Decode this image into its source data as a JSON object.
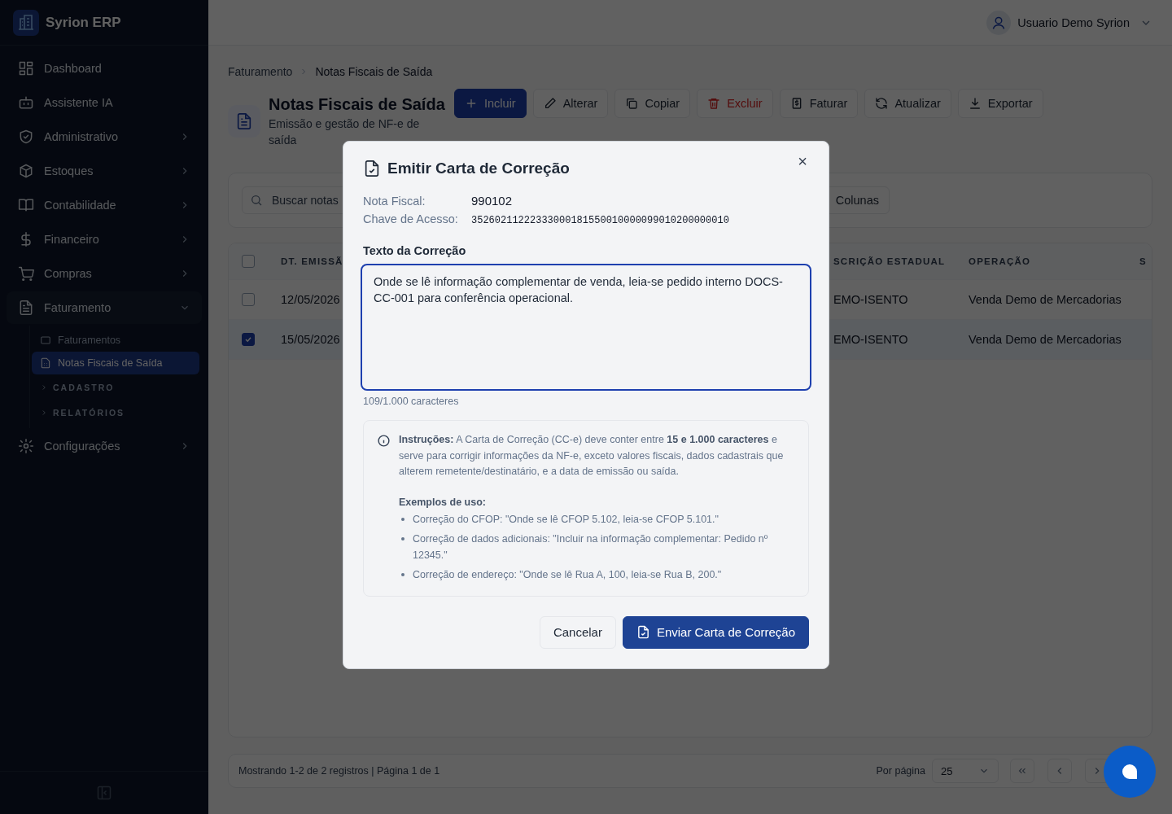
{
  "app": {
    "name": "Syrion ERP"
  },
  "sidebar": {
    "items": [
      {
        "label": "Dashboard",
        "kind": "link"
      },
      {
        "label": "Assistente IA",
        "kind": "link"
      },
      {
        "label": "Administrativo",
        "kind": "menu",
        "expanded": false
      },
      {
        "label": "Estoques",
        "kind": "menu",
        "expanded": false
      },
      {
        "label": "Contabilidade",
        "kind": "menu",
        "expanded": false
      },
      {
        "label": "Financeiro",
        "kind": "menu",
        "expanded": false
      },
      {
        "label": "Compras",
        "kind": "menu",
        "expanded": false
      },
      {
        "label": "Faturamento",
        "kind": "menu",
        "expanded": true,
        "children": [
          {
            "label": "Faturamentos",
            "kind": "page",
            "selected": false
          },
          {
            "label": "Notas Fiscais de Saída",
            "kind": "page",
            "selected": true
          },
          {
            "label": "CADASTRO",
            "kind": "group",
            "expanded": false
          },
          {
            "label": "RELATÓRIOS",
            "kind": "group",
            "expanded": false
          }
        ]
      },
      {
        "label": "Configurações",
        "kind": "menu",
        "expanded": false
      }
    ]
  },
  "user": {
    "name": "Usuario Demo Syrion"
  },
  "breadcrumb": [
    "Faturamento",
    "Notas Fiscais de Saída"
  ],
  "page": {
    "title": "Notas Fiscais de Saída",
    "subtitle": "Emissão e gestão de NF-e de saída"
  },
  "toolbar": [
    {
      "label": "Incluir",
      "kind": "primary"
    },
    {
      "label": "Alterar",
      "kind": "default"
    },
    {
      "label": "Copiar",
      "kind": "default"
    },
    {
      "label": "Excluir",
      "kind": "danger"
    },
    {
      "label": "Faturar",
      "kind": "default"
    },
    {
      "label": "Atualizar",
      "kind": "default"
    },
    {
      "label": "Exportar",
      "kind": "default"
    }
  ],
  "filters": {
    "search": {
      "placeholder": "Buscar notas"
    },
    "columns_button": "Colunas"
  },
  "table": {
    "columns": [
      "DT. EMISSÃ",
      "SCRIÇÃO ESTADUAL",
      "OPERAÇÃO",
      "S"
    ],
    "header_checked": false,
    "rows": [
      {
        "selected": false,
        "cells": [
          "12/05/2026",
          "EMO-ISENTO",
          "Venda Demo de Mercadorias"
        ]
      },
      {
        "selected": true,
        "cells": [
          "15/05/2026",
          "EMO-ISENTO",
          "Venda Demo de Mercadorias"
        ]
      }
    ]
  },
  "footer": {
    "summary": "Mostrando 1-2 de 2 registros | Página 1 de 1",
    "per_page_label": "Por página",
    "per_page": "25"
  },
  "modal": {
    "title": "Emitir Carta de Correção",
    "close": "×",
    "fields": [
      {
        "label": "Nota Fiscal:",
        "value": "990102",
        "kind": "text"
      },
      {
        "label": "Chave de Acesso:",
        "value": "35260211222333000181550010000099010200000010",
        "kind": "mono"
      }
    ],
    "textarea": {
      "label": "Texto da Correção",
      "value": "Onde se lê informação complementar de venda, leia-se pedido interno DOCS-CC-001 para conferência operacional."
    },
    "counter": "109/1.000 caracteres",
    "info": {
      "text": "**Instruções:** A Carta de Correção (CC-e) deve conter entre **15 e 1.000 caracteres** e serve para corrigir informações da NF-e, exceto valores fiscais, dados cadastrais que alterem remetente/destinatário, e a data de emissão ou saída.",
      "examples_title": "Exemplos de uso:",
      "examples": [
        "Correção do CFOP: \"Onde se lê CFOP 5.102, leia-se CFOP 5.101.\"",
        "Correção de dados adicionais: \"Incluir na informação complementar: Pedido nº 12345.\"",
        "Correção de endereço: \"Onde se lê Rua A, 100, leia-se Rua B, 200.\""
      ]
    },
    "buttons": [
      {
        "label": "Cancelar",
        "kind": "secondary"
      },
      {
        "label": "Enviar Carta de Correção",
        "kind": "primary"
      }
    ]
  }
}
